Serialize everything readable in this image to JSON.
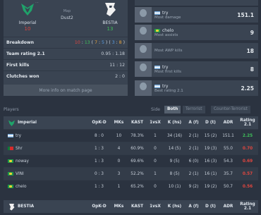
{
  "match": {
    "header_text": "...",
    "map_label": "Map",
    "map_name": "Dust2",
    "team1": {
      "name": "Imperial",
      "score": "10",
      "score_color": "#e0463f",
      "logo_color": "#1fa36a"
    },
    "team2": {
      "name": "BESTIA",
      "score": "13",
      "score_color": "#3fbf5a",
      "logo_color": "#f0f0f0"
    },
    "rows": [
      {
        "label": "Breakdown",
        "value": "10 : 13 ( 7 : 5 ) ( 3 : 8 )"
      },
      {
        "label": "Team rating 2.1",
        "value": "0.95 : 1.18"
      },
      {
        "label": "First kills",
        "value": "11 : 12"
      },
      {
        "label": "Clutches won",
        "value": "2 : 0"
      }
    ],
    "more_link": "More info on match page"
  },
  "highlights": [
    {
      "player": "try",
      "flag": "ar",
      "category": "Most damage",
      "value": "151.1"
    },
    {
      "player": "chelo",
      "flag": "br",
      "category": "Most assists",
      "value": "9"
    },
    {
      "player": "",
      "flag": "",
      "category": "Most AWP kills",
      "value": "18"
    },
    {
      "player": "try",
      "flag": "ar",
      "category": "Most first kills",
      "value": "8"
    },
    {
      "player": "try",
      "flag": "ar",
      "category": "Best rating 2.1",
      "value": "2.25"
    }
  ],
  "players_section": {
    "title": "Players",
    "side_label": "Side",
    "tabs": [
      "Both",
      "Terrorist",
      "Counter-Terrorist"
    ],
    "active_tab": "Both"
  },
  "table_columns": [
    "OpK-D",
    "MKs",
    "KAST",
    "1vsX",
    "K (hs)",
    "A (f)",
    "D (t)",
    "ADR",
    "Rating 2.1"
  ],
  "team1_table": {
    "team": "Imperial",
    "rows": [
      {
        "name": "try",
        "flag": "ar",
        "opkd": "8 : 0",
        "mks": "10",
        "kast": "78.3%",
        "clutch": "1",
        "khs": "34 (16)",
        "af": "2 (1)",
        "dt": "15 (2)",
        "adr": "151.1",
        "rating": "2.25",
        "rating_color": "#3fbf5a"
      },
      {
        "name": "Shr",
        "flag": "pt",
        "opkd": "1 : 3",
        "mks": "4",
        "kast": "60.9%",
        "clutch": "0",
        "khs": "14 (5)",
        "af": "2 (1)",
        "dt": "19 (3)",
        "adr": "55.0",
        "rating": "0.70",
        "rating_color": "#e0463f"
      },
      {
        "name": "noway",
        "flag": "br",
        "opkd": "1 : 3",
        "mks": "0",
        "kast": "69.6%",
        "clutch": "0",
        "khs": "9 (5)",
        "af": "6 (0)",
        "dt": "16 (3)",
        "adr": "54.3",
        "rating": "0.69",
        "rating_color": "#e0463f"
      },
      {
        "name": "VINI",
        "flag": "br",
        "opkd": "0 : 3",
        "mks": "3",
        "kast": "52.2%",
        "clutch": "1",
        "khs": "8 (5)",
        "af": "2 (1)",
        "dt": "16 (1)",
        "adr": "35.7",
        "rating": "0.57",
        "rating_color": "#e0463f"
      },
      {
        "name": "chelo",
        "flag": "br",
        "opkd": "1 : 3",
        "mks": "1",
        "kast": "65.2%",
        "clutch": "0",
        "khs": "10 (1)",
        "af": "9 (2)",
        "dt": "19 (2)",
        "adr": "50.7",
        "rating": "0.56",
        "rating_color": "#e0463f"
      }
    ]
  },
  "team2_table": {
    "team": "BESTIA"
  }
}
